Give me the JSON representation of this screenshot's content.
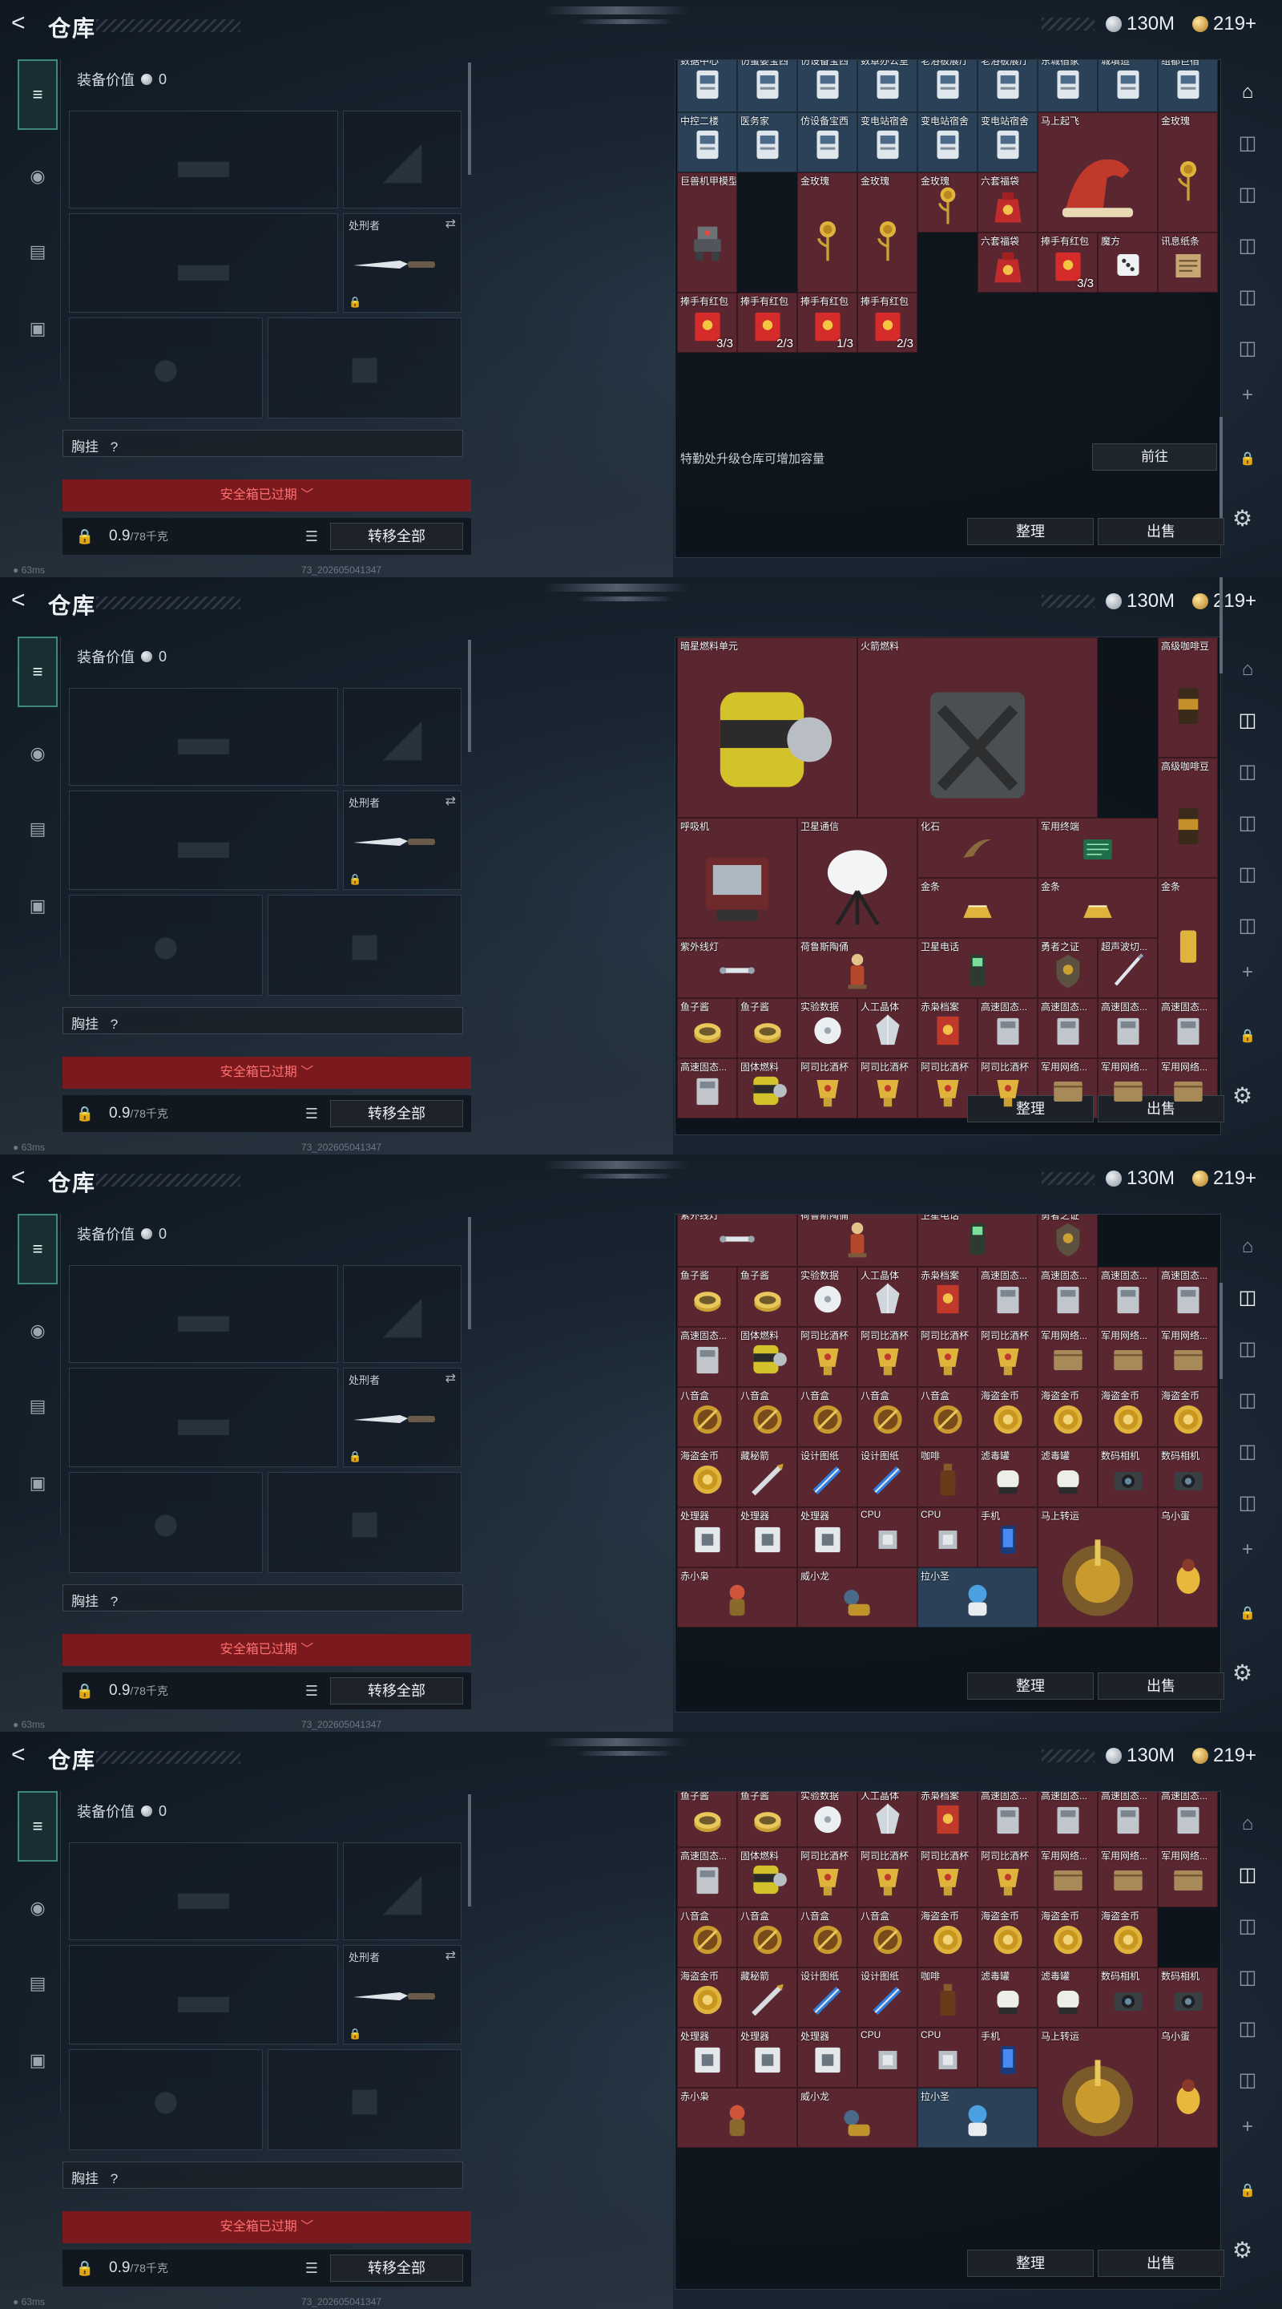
{
  "header": {
    "back_glyph": "<",
    "title": "仓库",
    "silver_amount": "130M",
    "gold_amount": "219+"
  },
  "equip": {
    "value_label": "装备价值",
    "value": "0",
    "knife_slot_label": "处刑者",
    "chest_label": "胸挂",
    "chest_hint": "?",
    "warning": "安全箱已过期 ﹀",
    "weight": "0.9",
    "weight_cap": "/78千克",
    "move_all": "转移全部"
  },
  "stash": {
    "footer_tip": "特勤处升级仓库可增加容量",
    "go_button": "前往",
    "sort_button": "整理",
    "sell_button": "出售"
  },
  "status": {
    "ping": "63ms",
    "build": "73_2026050413​47"
  },
  "colors": {
    "active_nav": "#3e8a78",
    "warning_bg": "#7a1a1e",
    "warning_text": "#ff6f6f"
  },
  "panels": [
    {
      "rows": [
        [
          "数据中心",
          "仿蛋婴宝西",
          "仿设备宝西",
          "数章办公室",
          "老浴板展厅",
          "老浴板展厅",
          "东城宿家",
          "城填造",
          "组都巨宿"
        ],
        [
          "中控二楼",
          "医务家",
          "仿设备宝西",
          "变电站宿舍",
          "变电站宿舍",
          "变电站宿舍",
          "马上起飞",
          "",
          "金玫瑰"
        ],
        [
          "巨兽机甲模型",
          "金玫瑰",
          "金玫瑰",
          "金玫瑰",
          "六套福袋",
          "",
          "",
          "",
          ""
        ],
        [
          "",
          "",
          "",
          "",
          "六套福袋",
          "捧手有红包",
          "魔方",
          "",
          "讯息纸条"
        ],
        [
          "捧手有红包",
          "捧手有红包",
          "捧手有红包",
          "捧手有红包",
          "",
          "",
          "",
          "",
          ""
        ]
      ],
      "counts": [
        "3/3",
        "3/3",
        "2/3",
        "1/3",
        "2/3"
      ]
    },
    {
      "rows": [
        [
          "暗星燃料单元",
          "火箭燃料",
          "高级咖啡豆"
        ],
        [
          "高级咖啡豆"
        ],
        [
          "呼吸机",
          "卫星通信",
          "化石",
          "军用终端"
        ],
        [
          "金条",
          "金条",
          "金条"
        ],
        [
          "紫外线灯",
          "荷鲁斯陶俑",
          "卫星电话",
          "勇者之证",
          "超声波切..."
        ],
        [
          "鱼子酱",
          "鱼子酱",
          "实验数据",
          "人工晶体",
          "赤枭档案",
          "高速固态...",
          "高速固态...",
          "高速固态...",
          "高速固态..."
        ],
        [
          "高速固态...",
          "固体燃料",
          "阿司比酒杯",
          "阿司比酒杯",
          "阿司比酒杯",
          "阿司比酒杯",
          "军用网络...",
          "军用网络...",
          "军用网络..."
        ]
      ]
    },
    {
      "rows": [
        [
          "紫外线灯",
          "荷鲁斯陶俑",
          "卫星电话",
          "勇者之证"
        ],
        [
          "鱼子酱",
          "鱼子酱",
          "实验数据",
          "人工晶体",
          "赤枭档案",
          "高速固态...",
          "高速固态...",
          "高速固态...",
          "高速固态..."
        ],
        [
          "高速固态...",
          "固体燃料",
          "阿司比酒杯",
          "阿司比酒杯",
          "阿司比酒杯",
          "阿司比酒杯",
          "军用网络...",
          "军用网络...",
          "军用网络..."
        ],
        [
          "八音盒",
          "八音盒",
          "八音盒",
          "八音盒",
          "八音盒",
          "海盗金币",
          "海盗金币",
          "海盗金币",
          "海盗金币"
        ],
        [
          "海盗金币",
          "藏秘箭",
          "设计图纸",
          "设计图纸",
          "咖啡",
          "滤毒罐",
          "滤毒罐",
          "数码相机",
          "数码相机"
        ],
        [
          "处理器",
          "处理器",
          "处理器",
          "CPU",
          "CPU",
          "手机",
          "马上转运",
          "",
          "乌小蛋"
        ],
        [
          "赤小枭",
          "",
          "威小龙",
          "",
          "拉小圣",
          "",
          "",
          "",
          ""
        ]
      ]
    },
    {
      "rows": [
        [
          "鱼子酱",
          "鱼子酱",
          "实验数据",
          "人工晶体",
          "赤枭档案",
          "高速固态...",
          "高速固态...",
          "高速固态...",
          "高速固态..."
        ],
        [
          "高速固态...",
          "固体燃料",
          "阿司比酒杯",
          "阿司比酒杯",
          "阿司比酒杯",
          "阿司比酒杯",
          "军用网络...",
          "军用网络...",
          "军用网络..."
        ],
        [
          "八音盒",
          "八音盒",
          "八音盒",
          "八音盒",
          "海盗金币",
          "海盗金币",
          "海盗金币",
          "海盗金币",
          ""
        ],
        [
          "海盗金币",
          "藏秘箭",
          "设计图纸",
          "设计图纸",
          "咖啡",
          "滤毒罐",
          "滤毒罐",
          "数码相机",
          "数码相机"
        ],
        [
          "处理器",
          "处理器",
          "处理器",
          "CPU",
          "CPU",
          "手机",
          "马上转运",
          "",
          "乌小蛋"
        ],
        [
          "赤小枭",
          "",
          "威小龙",
          "",
          "拉小圣",
          "",
          "",
          "",
          ""
        ]
      ]
    }
  ]
}
